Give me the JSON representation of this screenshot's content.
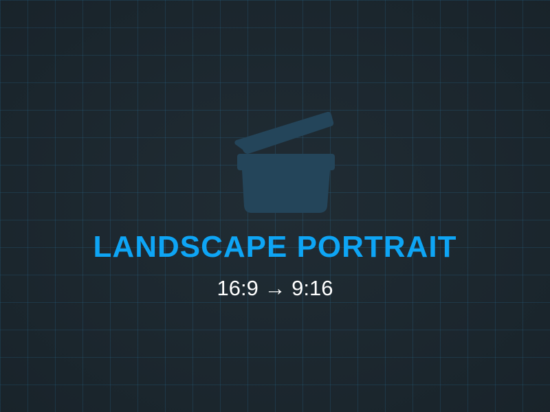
{
  "title": "LANDSCAPE PORTRAIT",
  "subtitle": "16:9 → 9:16",
  "icon": "clapperboard-icon",
  "colors": {
    "background": "#1c2830",
    "grid": "#286e96",
    "title": "#0ea5f5",
    "subtitle": "#ffffff",
    "icon": "#24455a"
  }
}
